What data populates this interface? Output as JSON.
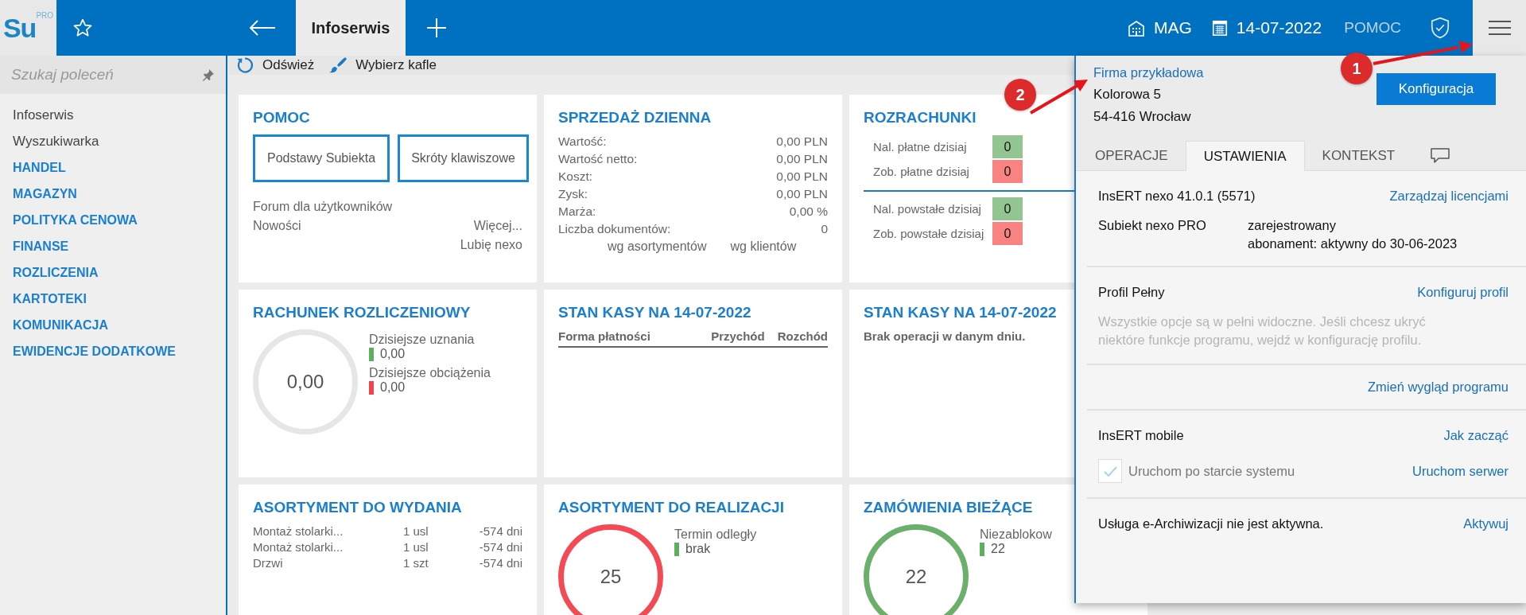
{
  "topbar": {
    "logo": "Su",
    "logo_badge": "PRO",
    "tab": {
      "label": "Infoserwis",
      "selected": true
    },
    "warehouse": "MAG",
    "date": "14-07-2022",
    "help": "POMOC"
  },
  "sidebar": {
    "search": {
      "placeholder": "Szukaj poleceń"
    },
    "items": [
      {
        "label": "Infoserwis",
        "kind": "link"
      },
      {
        "label": "Wyszukiwarka",
        "kind": "link"
      },
      {
        "label": "HANDEL",
        "kind": "section"
      },
      {
        "label": "MAGAZYN",
        "kind": "section"
      },
      {
        "label": "POLITYKA CENOWA",
        "kind": "section"
      },
      {
        "label": "FINANSE",
        "kind": "section"
      },
      {
        "label": "ROZLICZENIA",
        "kind": "section"
      },
      {
        "label": "KARTOTEKI",
        "kind": "section"
      },
      {
        "label": "KOMUNIKACJA",
        "kind": "section"
      },
      {
        "label": "EWIDENCJE DODATKOWE",
        "kind": "section"
      }
    ]
  },
  "toolbar": [
    {
      "label": "Odśwież",
      "kind": "refresh"
    },
    {
      "label": "Wybierz kafle",
      "kind": "brush"
    }
  ],
  "tiles": [
    {
      "kind": "help",
      "title": "POMOC",
      "buttons": [
        "Podstawy Subiekta",
        "Skróty klawiszowe"
      ],
      "link_rows": [
        {
          "left": "Forum dla użytkowników"
        },
        {
          "left": "Nowości",
          "right": "Więcej..."
        },
        {
          "right": "Lubię nexo"
        }
      ]
    },
    {
      "kind": "sales",
      "title": "SPRZEDAŻ DZIENNA",
      "rows": [
        {
          "label": "Wartość:",
          "value": "0,00 PLN"
        },
        {
          "label": "Wartość netto:",
          "value": "0,00 PLN"
        },
        {
          "label": "Koszt:",
          "value": "0,00 PLN"
        },
        {
          "label": "Zysk:",
          "value": "0,00 PLN"
        },
        {
          "label": "Marża:",
          "value": "0,00 %"
        },
        {
          "label": "Liczba dokumentów:",
          "value": "0"
        }
      ],
      "links": [
        "wg asortymentów",
        "wg klientów"
      ]
    },
    {
      "kind": "settlements",
      "title": "ROZRACHUNKI",
      "groups": [
        [
          {
            "label": "Nal. płatne dzisiaj",
            "value": "0",
            "color": "#93c593"
          },
          {
            "label": "Zob. płatne dzisiaj",
            "value": "0",
            "color": "#f98383"
          }
        ],
        [
          {
            "label": "Nal. powstałe dzisiaj",
            "value": "0",
            "color": "#93c593"
          },
          {
            "label": "Zob. powstałe dzisiaj",
            "value": "0",
            "color": "#f98383"
          }
        ]
      ]
    },
    {
      "kind": "ring",
      "title": "RACHUNEK ROZLICZENIOWY",
      "value": "0,00",
      "color": "#e6e6e6",
      "legend": [
        {
          "label": "Dzisiejsze uznania",
          "value": "0,00",
          "color": "#5fae5f"
        },
        {
          "label": "Dzisiejsze obciążenia",
          "value": "0,00",
          "color": "#f2424f"
        }
      ]
    },
    {
      "kind": "table",
      "title": "STAN KASY NA 14-07-2022",
      "columns": [
        "Forma płatności",
        "Przychód",
        "Rozchód"
      ]
    },
    {
      "kind": "message",
      "title": "STAN KASY NA 14-07-2022",
      "text": "Brak operacji w danym dniu."
    },
    {
      "kind": "list",
      "title": "ASORTYMENT DO WYDANIA",
      "rows": [
        {
          "name": "Montaż stolarki...",
          "qty": "1 usl",
          "days": "-574 dni"
        },
        {
          "name": "Montaż stolarki...",
          "qty": "1 usl",
          "days": "-574 dni"
        },
        {
          "name": "Drzwi",
          "qty": "1 szt",
          "days": "-574 dni"
        }
      ]
    },
    {
      "kind": "ring",
      "title": "ASORTYMENT DO REALIZACJI",
      "value": "25",
      "color": "#f44a55",
      "legend": [
        {
          "label": "Termin odległy",
          "value": "brak",
          "color": "#5fae5f"
        }
      ]
    },
    {
      "kind": "ring",
      "title": "ZAMÓWIENIA BIEŻĄCE",
      "value": "22",
      "color": "#6aaf6a",
      "legend": [
        {
          "label": "Niezablokow",
          "value": "22",
          "color": "#5fae5f"
        }
      ]
    }
  ],
  "panel": {
    "company": {
      "name": "Firma przykładowa",
      "street": "Kolorowa 5",
      "city": "54-416 Wrocław"
    },
    "config_button": "Konfiguracja",
    "tabs": [
      {
        "label": "OPERACJE",
        "kind": "text",
        "selected": false
      },
      {
        "label": "USTAWIENIA",
        "kind": "text",
        "selected": true
      },
      {
        "label": "KONTEKST",
        "kind": "text",
        "selected": false
      },
      {
        "kind": "comment",
        "selected": false
      }
    ],
    "version": "InsERT nexo 41.0.1 (5571)",
    "license_link": "Zarządzaj licencjami",
    "product": "Subiekt nexo PRO",
    "product_status": [
      "zarejestrowany",
      "abonament: aktywny do 30-06-2023"
    ],
    "profile": "Profil Pełny",
    "profile_link": "Konfiguruj profil",
    "profile_note": "Wszystkie opcje są w pełni widoczne. Jeśli chcesz ukryć niektóre funkcje programu, wejdź w konfigurację profilu.",
    "appearance_link": "Zmień wygląd programu",
    "mobile": "InsERT mobile",
    "mobile_link": "Jak zacząć",
    "autostart": {
      "label": "Uruchom po starcie systemu",
      "checked": true,
      "disabled": true
    },
    "server_link": "Uruchom serwer",
    "archive": "Usługa e-Archiwizacji nie jest aktywna.",
    "archive_link": "Aktywuj"
  },
  "annotations": [
    {
      "label": "1"
    },
    {
      "label": "2"
    }
  ]
}
